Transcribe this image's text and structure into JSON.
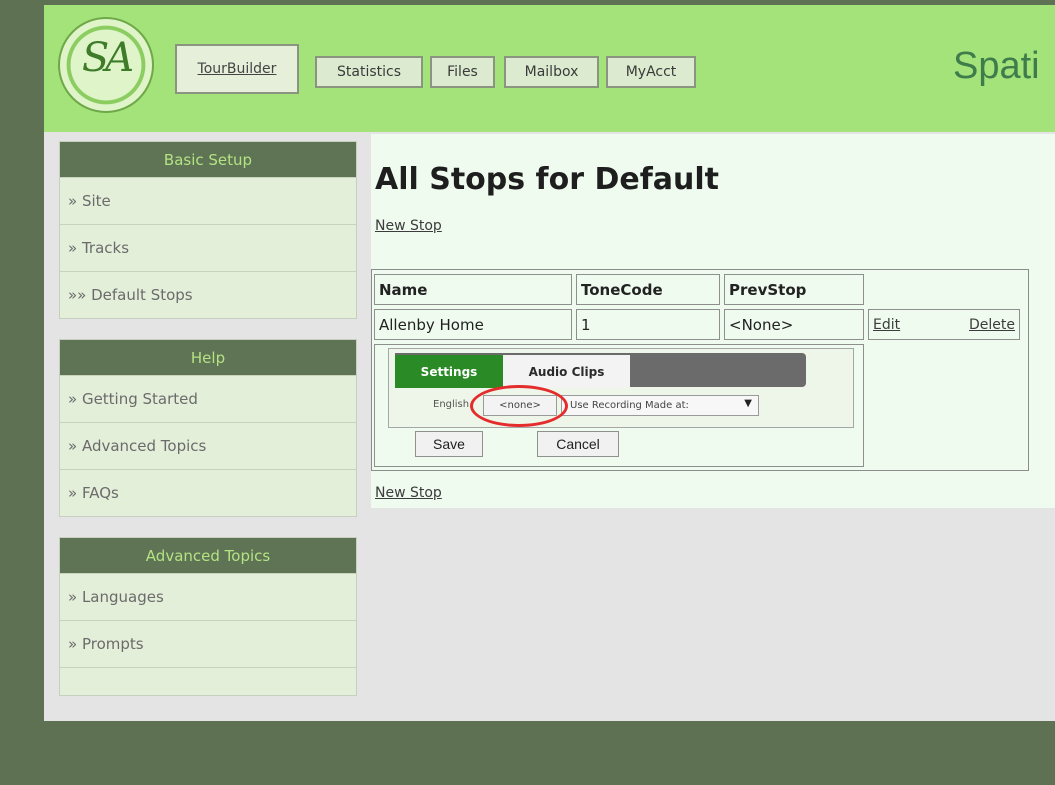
{
  "header": {
    "logo_text": "SA",
    "brand_text": "Spati",
    "nav": [
      {
        "label": "TourBuilder"
      },
      {
        "label": "Statistics"
      },
      {
        "label": "Files"
      },
      {
        "label": "Mailbox"
      },
      {
        "label": "MyAcct"
      }
    ]
  },
  "sidebar": {
    "groups": [
      {
        "title": "Basic Setup",
        "items": [
          "» Site",
          "» Tracks",
          "»» Default Stops"
        ]
      },
      {
        "title": "Help",
        "items": [
          "» Getting Started",
          "» Advanced Topics",
          "» FAQs"
        ]
      },
      {
        "title": "Advanced Topics",
        "items": [
          "» Languages",
          "» Prompts"
        ]
      }
    ]
  },
  "main": {
    "title": "All Stops for Default",
    "new_stop_top": "New Stop",
    "new_stop_bottom": "New Stop",
    "table": {
      "headers": [
        "Name",
        "ToneCode",
        "PrevStop"
      ],
      "row": {
        "name": "Allenby Home",
        "tone_code": "1",
        "prev_stop": "<None>",
        "edit": "Edit",
        "delete": "Delete"
      }
    },
    "editor": {
      "tab_settings": "Settings",
      "tab_audio": "Audio Clips",
      "language_label": "English",
      "none_value": "<none>",
      "recording_select": "Use Recording Made at:",
      "save": "Save",
      "cancel": "Cancel"
    }
  },
  "colors": {
    "header_bg": "#a4e27a",
    "sidebar_head": "#5f7355",
    "settings_tab": "#2a8a25",
    "highlight": "#e52c2c"
  }
}
